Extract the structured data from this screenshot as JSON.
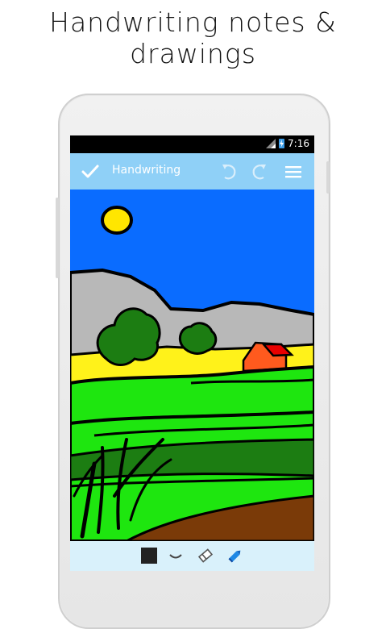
{
  "headline": "Handwriting notes & drawings",
  "status_bar": {
    "time": "7:16"
  },
  "app_bar": {
    "title": "Handwriting",
    "icons": [
      "check-icon",
      "undo-icon",
      "redo-icon",
      "menu-icon"
    ]
  },
  "toolbar": {
    "tools": [
      "color-swatch",
      "brush-stroke-icon",
      "eraser-icon",
      "pencil-icon"
    ],
    "selected_color": "#222222"
  },
  "colors": {
    "app_bar": "#8fd0f7",
    "toolbar": "#d9f1fb",
    "sky": "#0a6cff"
  }
}
